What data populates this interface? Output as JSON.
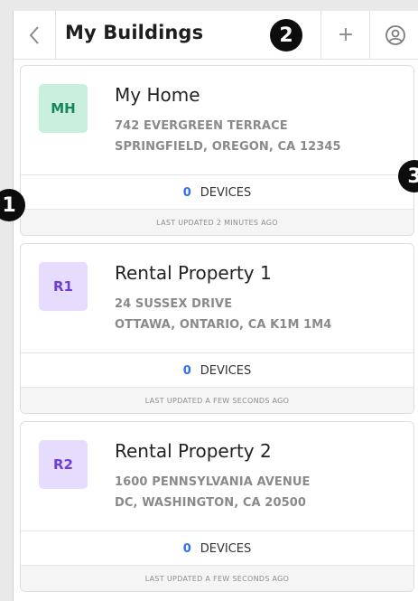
{
  "header": {
    "title": "My Buildings",
    "back_icon": "chevron-left-icon",
    "add_label": "+",
    "account_icon": "user-circle-icon"
  },
  "buildings": [
    {
      "initials": "MH",
      "avatar_bg": "#c8f0dc",
      "avatar_color": "#17875a",
      "name": "My Home",
      "address_line1": "742 EVERGREEN TERRACE",
      "address_line2": "SPRINGFIELD, OREGON, CA 12345",
      "devices_count": "0",
      "devices_label": "DEVICES",
      "last_updated": "LAST UPDATED 2 MINUTES AGO"
    },
    {
      "initials": "R1",
      "avatar_bg": "#e6dcfd",
      "avatar_color": "#6d3fd6",
      "name": "Rental Property 1",
      "address_line1": "24 SUSSEX DRIVE",
      "address_line2": "OTTAWA, ONTARIO, CA K1M 1M4",
      "devices_count": "0",
      "devices_label": "DEVICES",
      "last_updated": "LAST UPDATED A FEW SECONDS AGO"
    },
    {
      "initials": "R2",
      "avatar_bg": "#e6dcfd",
      "avatar_color": "#6d3fd6",
      "name": "Rental Property 2",
      "address_line1": "1600 PENNSYLVANIA AVENUE",
      "address_line2": "DC, WASHINGTON, CA 20500",
      "devices_count": "0",
      "devices_label": "DEVICES",
      "last_updated": "LAST UPDATED A FEW SECONDS AGO"
    }
  ],
  "markers": [
    "1",
    "2",
    "3"
  ]
}
